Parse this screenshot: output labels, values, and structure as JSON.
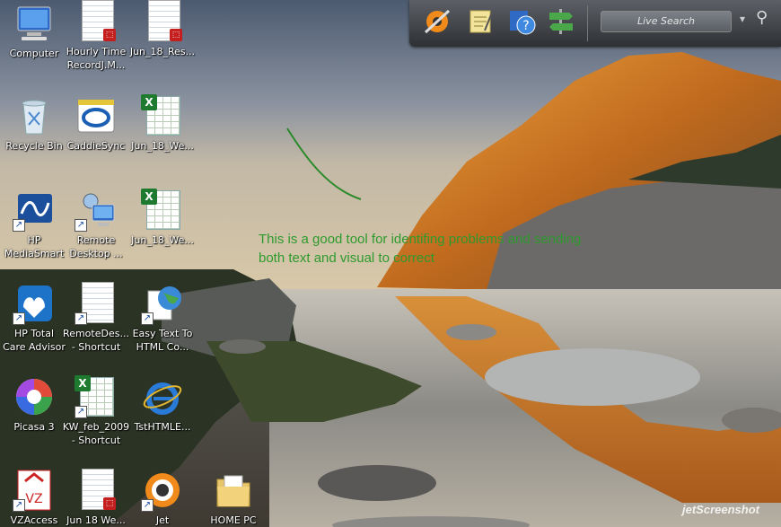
{
  "desktop": {
    "icons": [
      {
        "label": "Computer"
      },
      {
        "label": "Hourly Time\nRecordJ.M..."
      },
      {
        "label": "Jun_18_Res..."
      },
      {
        "label": "Recycle Bin"
      },
      {
        "label": "CaddieSync"
      },
      {
        "label": "Jun_18_We..."
      },
      {
        "label": "HP\nMediaSmart"
      },
      {
        "label": "Remote\nDesktop ..."
      },
      {
        "label": "Jun_18_We..."
      },
      {
        "label": "HP Total\nCare Advisor"
      },
      {
        "label": "RemoteDes...\n- Shortcut"
      },
      {
        "label": "Easy Text To\nHTML Co..."
      },
      {
        "label": "Picasa 3"
      },
      {
        "label": "KW_feb_2009\n- Shortcut"
      },
      {
        "label": "TstHTMLE..."
      },
      {
        "label": "VZAccess"
      },
      {
        "label": "Jun 18 We..."
      },
      {
        "label": "Jet"
      },
      {
        "label": "HOME PC"
      }
    ]
  },
  "sidebar": {
    "search_placeholder": "Live Search",
    "dropdown_glyph": "▾",
    "search_glyph": "⚲"
  },
  "annotation": {
    "line1": "This is a good tool for identifing problems and sending",
    "line2": "both text and visual to correct"
  },
  "watermark": "jetScreenshot"
}
